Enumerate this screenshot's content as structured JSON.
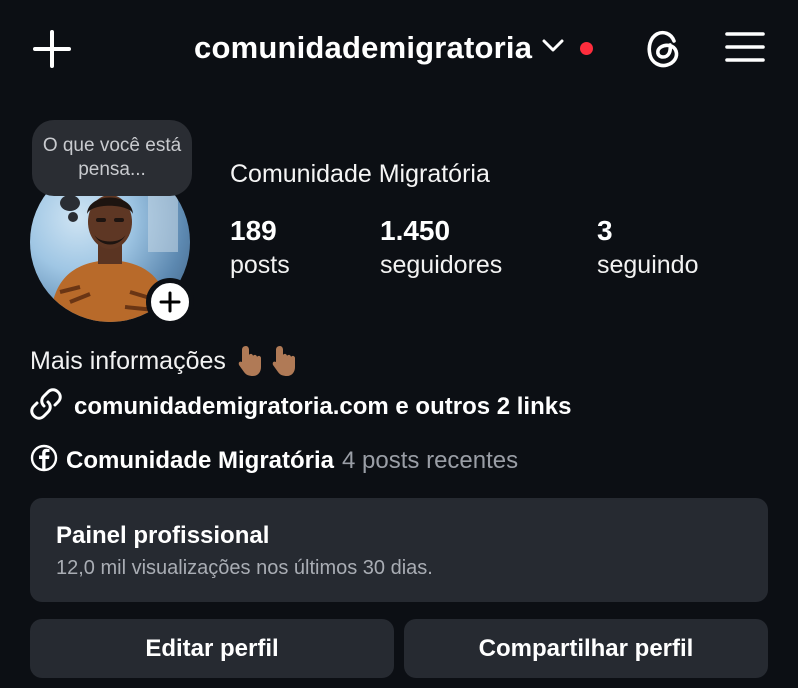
{
  "header": {
    "username": "comunidademigratoria",
    "notification_dot_color": "#ff2d3d"
  },
  "profile": {
    "note": "O que você está pensa...",
    "display_name": "Comunidade Migratória",
    "stats": [
      {
        "value": "189",
        "label": "posts"
      },
      {
        "value": "1.450",
        "label": "seguidores"
      },
      {
        "value": "3",
        "label": "seguindo"
      }
    ],
    "bio": "Mais informações",
    "bio_emoji": "👇🏽👇🏽",
    "link": "comunidademigratoria.com e outros 2 links",
    "facebook": {
      "name": "Comunidade Migratória",
      "meta": "4 posts recentes"
    }
  },
  "panel": {
    "title": "Painel profissional",
    "subtitle": "12,0 mil visualizações nos últimos 30 dias."
  },
  "buttons": {
    "edit": "Editar perfil",
    "share": "Compartilhar perfil"
  }
}
